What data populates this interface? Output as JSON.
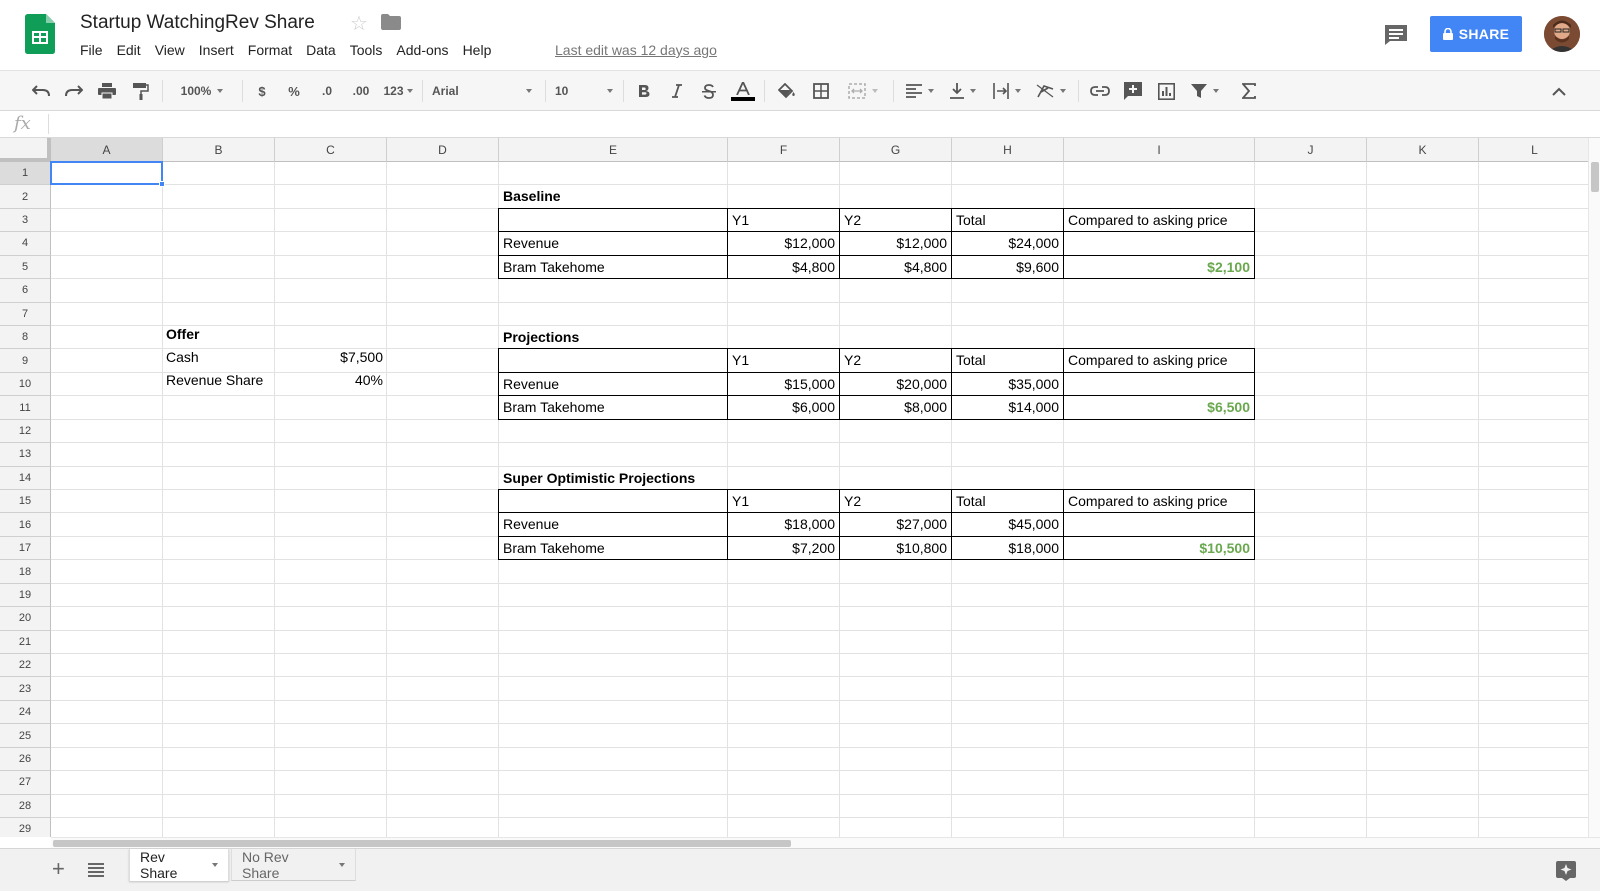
{
  "app": {
    "doc_title": "Startup WatchingRev Share",
    "menus": [
      "File",
      "Edit",
      "View",
      "Insert",
      "Format",
      "Data",
      "Tools",
      "Add-ons",
      "Help"
    ],
    "last_edit": "Last edit was 12 days ago",
    "share_label": "SHARE",
    "colors": {
      "share": "#4285f4",
      "logo": "#0f9d58",
      "positive": "#6aa84f"
    }
  },
  "toolbar": {
    "zoom": "100%",
    "currency": "$",
    "percent": "%",
    "decrease_decimals": ".0",
    "increase_decimals": ".00",
    "more_formats": "123",
    "font": "Arial",
    "font_size": "10"
  },
  "formula_bar": {
    "fx": "fx",
    "value": ""
  },
  "grid": {
    "columns": [
      "A",
      "B",
      "C",
      "D",
      "E",
      "F",
      "G",
      "H",
      "I",
      "J",
      "K",
      "L"
    ],
    "rows": [
      "1",
      "2",
      "3",
      "4",
      "5",
      "6",
      "7",
      "8",
      "9",
      "10",
      "11",
      "12",
      "13",
      "14",
      "15",
      "16",
      "17",
      "18",
      "19",
      "20",
      "21",
      "22",
      "23",
      "24",
      "25",
      "26",
      "27",
      "28",
      "29"
    ],
    "selected_cell": "A1",
    "offer": {
      "title": "Offer",
      "cash_label": "Cash",
      "cash_value": "$7,500",
      "share_label": "Revenue Share",
      "share_value": "40%"
    },
    "tables": [
      {
        "title": "Baseline",
        "headers": [
          "",
          "Y1",
          "Y2",
          "Total",
          "Compared to asking price"
        ],
        "rows": [
          [
            "Revenue",
            "$12,000",
            "$12,000",
            "$24,000",
            ""
          ],
          [
            "Bram Takehome",
            "$4,800",
            "$4,800",
            "$9,600",
            "$2,100"
          ]
        ]
      },
      {
        "title": "Projections",
        "headers": [
          "",
          "Y1",
          "Y2",
          "Total",
          "Compared to asking price"
        ],
        "rows": [
          [
            "Revenue",
            "$15,000",
            "$20,000",
            "$35,000",
            ""
          ],
          [
            "Bram Takehome",
            "$6,000",
            "$8,000",
            "$14,000",
            "$6,500"
          ]
        ]
      },
      {
        "title": "Super Optimistic Projections",
        "headers": [
          "",
          "Y1",
          "Y2",
          "Total",
          "Compared to asking price"
        ],
        "rows": [
          [
            "Revenue",
            "$18,000",
            "$27,000",
            "$45,000",
            ""
          ],
          [
            "Bram Takehome",
            "$7,200",
            "$10,800",
            "$18,000",
            "$10,500"
          ]
        ]
      }
    ]
  },
  "sheets": {
    "tabs": [
      "Rev Share",
      "No Rev Share"
    ],
    "active": "Rev Share"
  }
}
